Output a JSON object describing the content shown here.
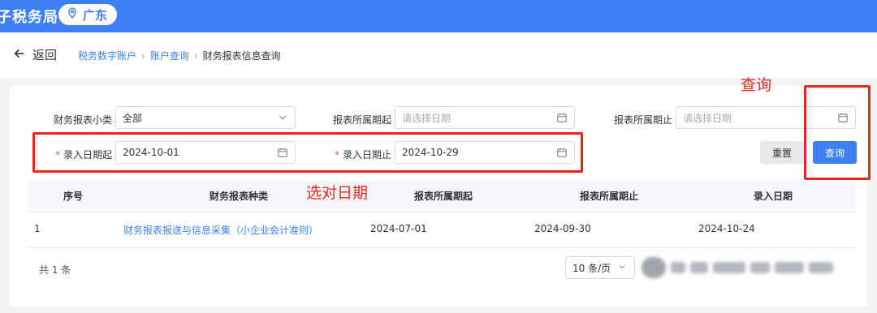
{
  "header": {
    "brand": "子税务局",
    "region": "广东",
    "region_icon": "location-pin-icon"
  },
  "nav": {
    "back_label": "返回",
    "breadcrumbs": [
      "税务数字账户",
      "账户查询",
      "财务报表信息查询"
    ]
  },
  "filters": {
    "category_label": "财务报表小类",
    "category_value": "全部",
    "period_start_label": "报表所属期起",
    "period_start_placeholder": "请选择日期",
    "period_end_label": "报表所属期止",
    "period_end_placeholder": "请选择日期",
    "entry_start_label": "录入日期起",
    "entry_start_value": "2024-10-01",
    "entry_end_label": "录入日期止",
    "entry_end_value": "2024-10-29",
    "reset_label": "重置",
    "query_label": "查询"
  },
  "table": {
    "columns": [
      "序号",
      "财务报表种类",
      "报表所属期起",
      "报表所属期止",
      "录入日期"
    ],
    "rows": [
      [
        "1",
        "财务报表报送与信息采集（小企业会计准则）",
        "2024-07-01",
        "2024-09-30",
        "2024-10-24"
      ]
    ]
  },
  "pagination": {
    "total": "共 1 条",
    "page_size": "10 条/页"
  },
  "annotations": {
    "query_note": "查询",
    "date_note": "选对日期",
    "color": "#e8271f"
  },
  "colors": {
    "brand_blue": "#3d80f3"
  }
}
